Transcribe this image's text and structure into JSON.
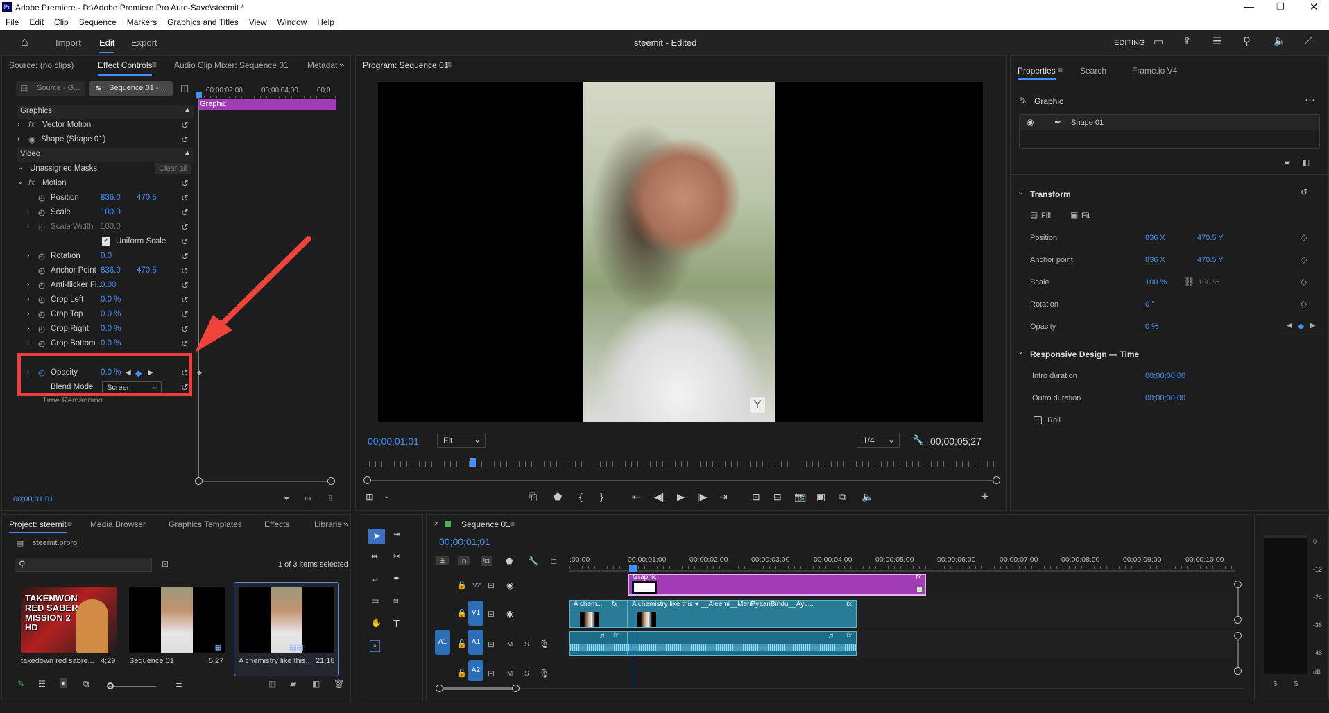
{
  "title_bar": {
    "title": "Adobe Premiere - D:\\Adobe Premiere Pro Auto-Save\\steemit *",
    "app_icon_text": "Pr"
  },
  "menu": [
    "File",
    "Edit",
    "Clip",
    "Sequence",
    "Markers",
    "Graphics and Titles",
    "View",
    "Window",
    "Help"
  ],
  "header": {
    "import": "Import",
    "edit": "Edit",
    "export": "Export",
    "doc_title": "steemit - Edited",
    "workspace": "EDITING"
  },
  "effect_controls": {
    "tabs": [
      "Source: (no clips)",
      "Effect Controls",
      "Audio Clip Mixer: Sequence 01",
      "Metadat"
    ],
    "source_dropdown": "Source - G...",
    "sequence_dropdown": "Sequence 01 - ...",
    "ruler": [
      "00;00;02;00",
      "00;00;04;00",
      "00;0"
    ],
    "graphic_bar": "Graphic",
    "section_graphics": "Graphics",
    "vector_motion": "Vector Motion",
    "shape": "Shape (Shape 01)",
    "section_video": "Video",
    "unassigned_masks": "Unassigned Masks",
    "clear_all": "Clear all",
    "motion": "Motion",
    "position": {
      "label": "Position",
      "x": "836.0",
      "y": "470.5"
    },
    "scale": {
      "label": "Scale",
      "value": "100.0"
    },
    "scale_width": {
      "label": "Scale Width",
      "value": "100.0"
    },
    "uniform_scale": "Uniform Scale",
    "rotation": {
      "label": "Rotation",
      "value": "0.0"
    },
    "anchor_point": {
      "label": "Anchor Point",
      "x": "836.0",
      "y": "470.5"
    },
    "anti_flicker": {
      "label": "Anti-flicker Fi...",
      "value": "0.00"
    },
    "crop_left": {
      "label": "Crop Left",
      "value": "0.0 %"
    },
    "crop_top": {
      "label": "Crop Top",
      "value": "0.0 %"
    },
    "crop_right": {
      "label": "Crop Right",
      "value": "0.0 %"
    },
    "crop_bottom": {
      "label": "Crop Bottom",
      "value": "0.0 %"
    },
    "opacity": {
      "label": "Opacity",
      "value": "0.0 %"
    },
    "blend_mode": {
      "label": "Blend Mode",
      "value": "Screen"
    },
    "time_remapping": "Time Remapping",
    "timecode": "00;00;01;01"
  },
  "program": {
    "tab": "Program: Sequence 01",
    "timecode": "00;00;01;01",
    "fit": "Fit",
    "quality": "1/4",
    "duration": "00;00;05;27"
  },
  "properties": {
    "tabs": [
      "Properties",
      "Search",
      "Frame.io V4"
    ],
    "graphic": "Graphic",
    "shape": "Shape 01",
    "transform": "Transform",
    "fill": "Fill",
    "fit": "Fit",
    "position": {
      "label": "Position",
      "x": "836 X",
      "y": "470.5 Y"
    },
    "anchor": {
      "label": "Anchor point",
      "x": "836 X",
      "y": "470.5 Y"
    },
    "scale": {
      "label": "Scale",
      "value": "100 %",
      "value2": "100 %"
    },
    "rotation": {
      "label": "Rotation",
      "value": "0 °"
    },
    "opacity": {
      "label": "Opacity",
      "value": "0 %"
    },
    "responsive": "Responsive Design — Time",
    "intro": {
      "label": "Intro duration",
      "value": "00;00;00;00"
    },
    "outro": {
      "label": "Outro duration",
      "value": "00;00;00;00"
    },
    "roll": "Roll"
  },
  "project": {
    "tabs": [
      "Project: steemit",
      "Media Browser",
      "Graphics Templates",
      "Effects",
      "Librarie"
    ],
    "file": "steemit.prproj",
    "count": "1 of 3 items selected",
    "items": [
      {
        "name": "takedown red sabre...",
        "duration": "4;29",
        "thumb_text": "TAKENWON\nRED SABER\nMISSION 2\nHD"
      },
      {
        "name": "Sequence 01",
        "duration": "5;27"
      },
      {
        "name": "A chemistry like this...",
        "duration": "21;18"
      }
    ]
  },
  "timeline": {
    "tab": "Sequence 01",
    "timecode": "00;00;01;01",
    "ruler": [
      ":00;00",
      "00;00;01;00",
      "00;00;02;00",
      "00;00;03;00",
      "00;00;04;00",
      "00;00;05;00",
      "00;00;06;00",
      "00;00;07;00",
      "00;00;08;00",
      "00;00;09;00",
      "00;00;10;00"
    ],
    "tracks": {
      "v2": "V2",
      "v1": "V1",
      "a1": "A1",
      "a2": "A2",
      "m": "M",
      "s": "S"
    },
    "graphic_clip": "Graphic",
    "clip_short": "A chem...",
    "clip_long": "A chemistry like this ♥ __Aleemi__MeriPyaariBindu__Ayu...",
    "fx": "fx"
  },
  "meter": {
    "labels": [
      "0",
      "-12",
      "-24",
      "-36",
      "-48",
      "dB"
    ],
    "bottom": [
      "S",
      "S"
    ]
  }
}
